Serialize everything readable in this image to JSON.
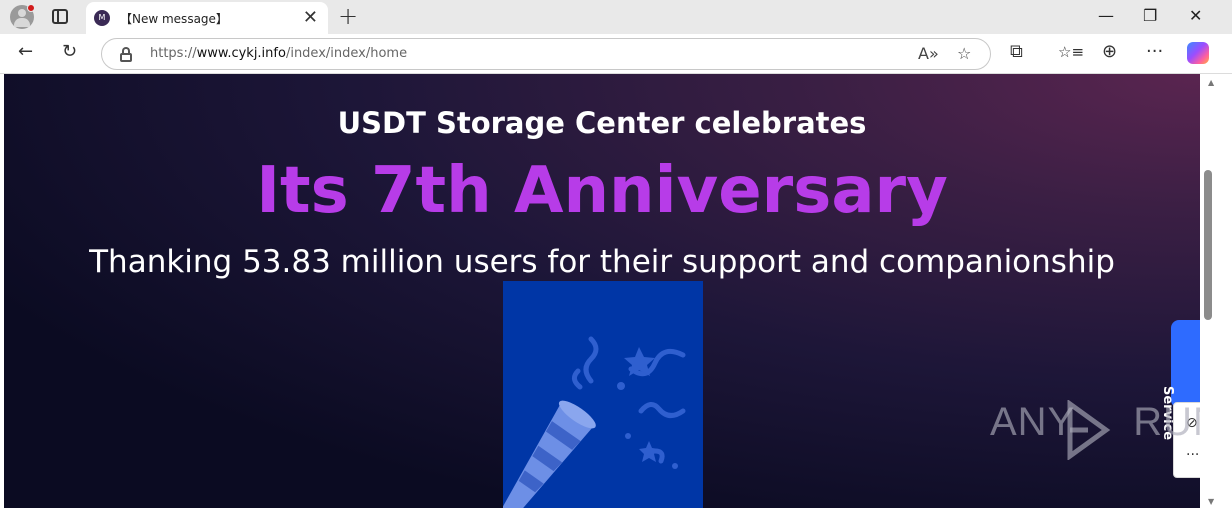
{
  "browser": {
    "tab": {
      "title": "【New message】",
      "favicon_letter": "M"
    },
    "url": {
      "prefix": "https://",
      "host": "www.cykj.info",
      "path": "/index/index/home"
    },
    "icons": {
      "profile": "profile-avatar-icon",
      "tab_actions": "tab-actions-icon",
      "new_tab": "plus-icon",
      "back": "arrow-left-icon",
      "refresh": "refresh-icon",
      "lock": "lock-icon",
      "read_aloud": "read-aloud-icon",
      "favorite": "star-icon",
      "extensions": "puzzle-icon",
      "favorites": "favorites-icon",
      "collections": "collections-icon",
      "more": "ellipsis-icon",
      "copilot": "copilot-icon"
    },
    "glyphs": {
      "close": "✕",
      "plus": "+",
      "minimize": "—",
      "restore": "❐",
      "close_window": "✕",
      "back": "←",
      "refresh": "↻",
      "read_aloud": "A»",
      "star": "☆",
      "puzzle": "⧉",
      "favorites": "☆≡",
      "collections": "⊕",
      "more": "···"
    }
  },
  "page": {
    "headline1": "USDT Storage Center celebrates",
    "headline2": "Its 7th Anniversary",
    "headline3": "Thanking 53.83 million users for their support and companionship",
    "service_tab": "Service",
    "side_panel": {
      "hide": "⊘",
      "more": "···"
    },
    "colors": {
      "accent_purple": "#b73ce8",
      "promo_blue": "#0036a6",
      "service_blue": "#2e6bff"
    }
  },
  "watermark": {
    "text_left": "ANY",
    "text_right": "RUN"
  }
}
